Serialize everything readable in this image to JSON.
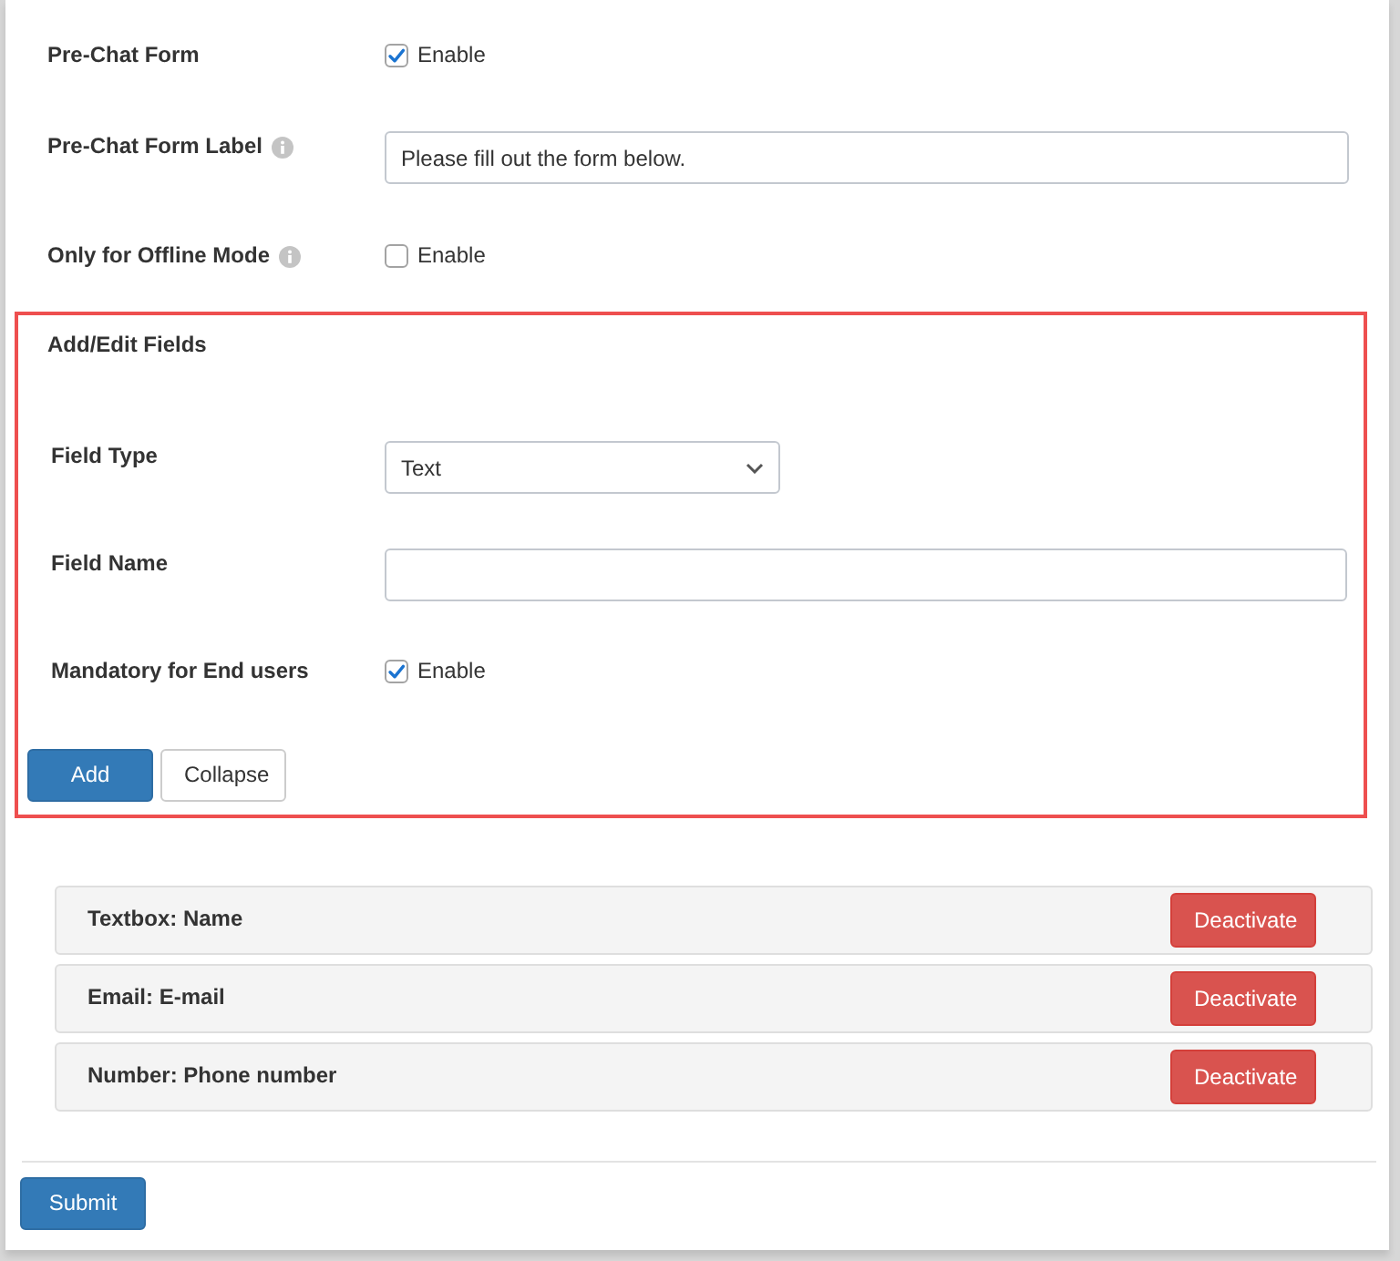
{
  "settings": [
    {
      "kind": "checkbox",
      "label": "Pre-Chat Form",
      "info": false,
      "checked": true,
      "option": "Enable"
    },
    {
      "kind": "text",
      "label": "Pre-Chat Form Label",
      "info": true,
      "value": "Please fill out the form below."
    },
    {
      "kind": "checkbox",
      "label": "Only for Offline Mode",
      "info": true,
      "checked": false,
      "option": "Enable"
    }
  ],
  "add_edit_fields": {
    "title": "Add/Edit Fields",
    "rows": [
      {
        "kind": "select",
        "label": "Field Type",
        "value": "Text"
      },
      {
        "kind": "text",
        "label": "Field Name"
      },
      {
        "kind": "checkbox",
        "label": "Mandatory for End users",
        "checked": true,
        "option": "Enable"
      }
    ],
    "buttons": [
      {
        "kind": "primary",
        "label": "Add"
      },
      {
        "kind": "default",
        "label": "Collapse"
      }
    ]
  },
  "fields": [
    {
      "label": "Textbox: Name",
      "action": "Deactivate"
    },
    {
      "label": "Email: E-mail",
      "action": "Deactivate"
    },
    {
      "label": "Number: Phone number",
      "action": "Deactivate"
    }
  ],
  "submit": {
    "label": "Submit"
  }
}
